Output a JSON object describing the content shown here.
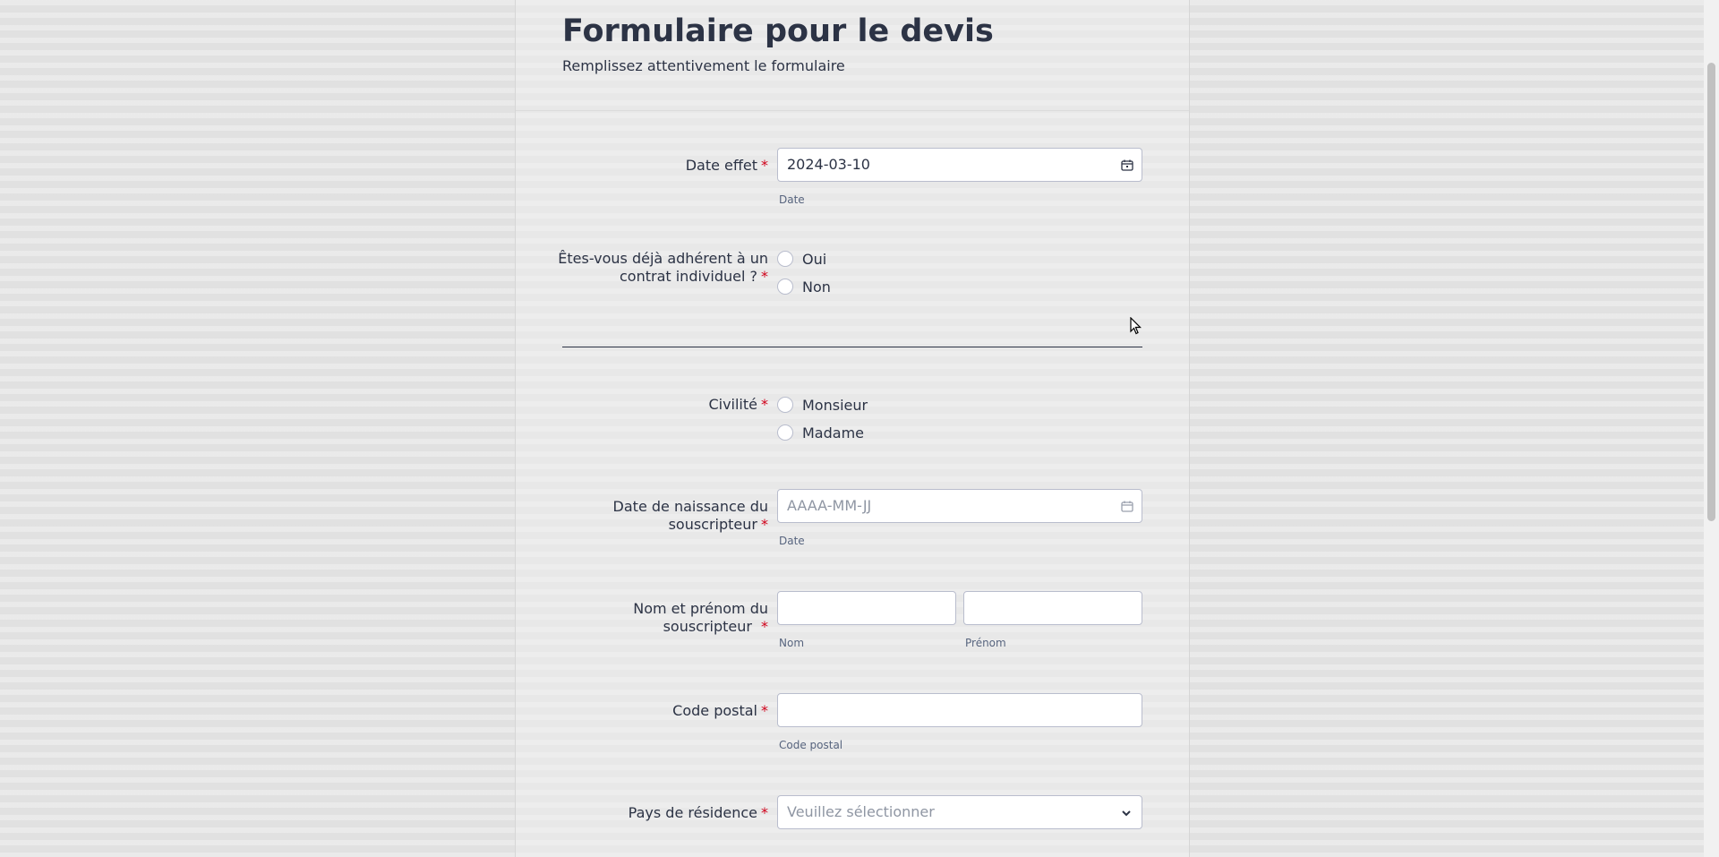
{
  "header": {
    "title": "Formulaire pour le devis",
    "subtitle": "Remplissez attentivement le formulaire"
  },
  "required_mark": "*",
  "fields": {
    "date_effet": {
      "label": "Date effet",
      "value": "2024-03-10",
      "sublabel": "Date",
      "icon": "calendar-icon"
    },
    "adherent": {
      "label_line1": "Êtes-vous déjà adhérent à un",
      "label_line2": "contrat individuel ?",
      "options": [
        "Oui",
        "Non"
      ]
    },
    "civilite": {
      "label": "Civilité",
      "options": [
        "Monsieur",
        "Madame"
      ]
    },
    "date_naissance": {
      "label_line1": "Date de naissance du",
      "label_line2": "souscripteur",
      "placeholder": "AAAA-MM-JJ",
      "sublabel": "Date",
      "icon": "calendar-icon"
    },
    "nom_prenom": {
      "label_line1": "Nom et prénom du",
      "label_line2": "souscripteur",
      "sublabel_nom": "Nom",
      "sublabel_prenom": "Prénom"
    },
    "code_postal": {
      "label": "Code postal",
      "sublabel": "Code postal"
    },
    "pays": {
      "label": "Pays de résidence",
      "placeholder": "Veuillez sélectionner",
      "icon": "chevron-down-icon"
    }
  },
  "colors": {
    "required": "#d0021b",
    "text": "#2c3345",
    "border": "#b9bdcd"
  }
}
